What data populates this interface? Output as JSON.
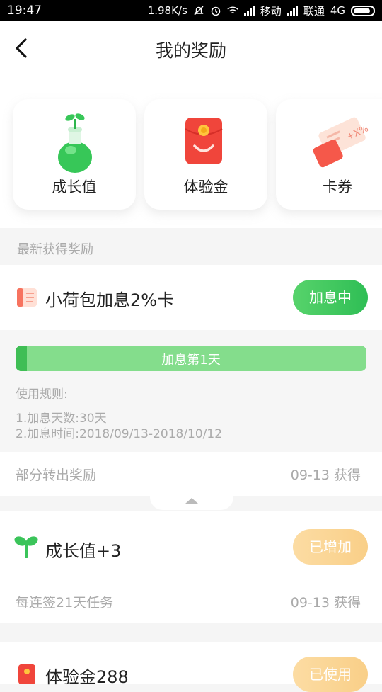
{
  "status_bar": {
    "time": "19:47",
    "speed": "1.98K/s",
    "carrier1": "移动",
    "carrier2": "联通",
    "network": "4G"
  },
  "header": {
    "title": "我的奖励"
  },
  "reward_types": [
    {
      "label": "成长值",
      "icon": "seedling-flask-icon"
    },
    {
      "label": "体验金",
      "icon": "red-envelope-icon"
    },
    {
      "label": "卡券",
      "icon": "coupon-ticket-icon"
    }
  ],
  "section_title": "最新获得奖励",
  "rewards": [
    {
      "name": "小荷包加息2%卡",
      "icon": "coupon-card-icon",
      "status": "加息中",
      "status_color": "#3fc35a",
      "progress_text": "加息第1天",
      "progress_fraction": 0.033,
      "rules_title": "使用规则:",
      "rules": [
        "1.加息天数:30天",
        "2.加息时间:2018/09/13-2018/10/12"
      ],
      "source": "部分转出奖励",
      "date": "09-13 获得"
    },
    {
      "name": "成长值+3",
      "icon": "sprout-icon",
      "status": "已增加",
      "status_color": "#fbd795",
      "source": "每连签21天任务",
      "date": "09-13 获得"
    },
    {
      "name": "体验金288",
      "icon": "red-envelope-icon",
      "status": "已使用",
      "status_color": "#fbd795"
    }
  ]
}
